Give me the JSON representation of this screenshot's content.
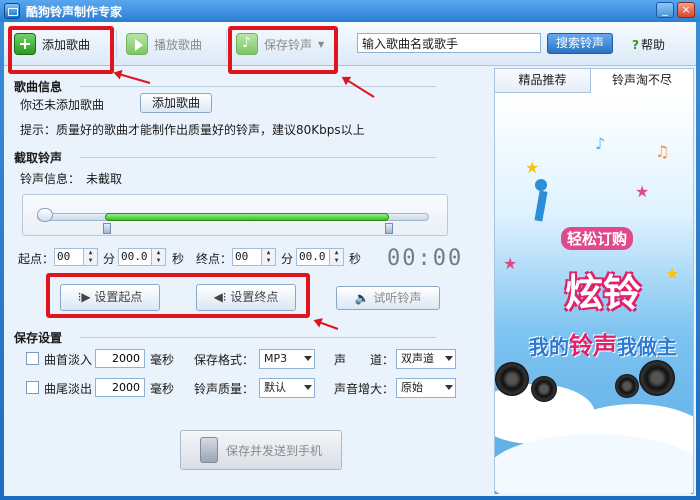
{
  "window": {
    "title": "酷狗铃声制作专家",
    "min": "_",
    "close": "×"
  },
  "toolbar": {
    "add_song": "添加歌曲",
    "play_song": "播放歌曲",
    "save_ringtone": "保存铃声",
    "search_placeholder": "输入歌曲名或歌手",
    "search_button": "搜索铃声",
    "help": "帮助"
  },
  "song_info": {
    "heading": "歌曲信息",
    "status": "你还未添加歌曲",
    "add_button": "添加歌曲",
    "tip": "提示：质量好的歌曲才能制作出质量好的铃声，建议80Kbps以上"
  },
  "cut": {
    "heading": "截取铃声",
    "info_label": "铃声信息：",
    "info_value": "未截取",
    "start_label": "起点：",
    "start_min": "00",
    "min_unit": "分",
    "start_sec": "00.0",
    "sec_unit": "秒",
    "end_label": "终点：",
    "end_min": "00",
    "end_sec": "00.0",
    "timer": "00:00",
    "set_start": "设置起点",
    "set_end": "设置终点",
    "preview": "试听铃声"
  },
  "save_settings": {
    "heading": "保存设置",
    "fade_in_label": "曲首淡入",
    "fade_in_value": "2000",
    "fade_out_label": "曲尾淡出",
    "fade_out_value": "2000",
    "ms_unit": "毫秒",
    "format_label": "保存格式：",
    "format_value": "MP3",
    "channel_label": "声　　道：",
    "channel_value": "双声道",
    "quality_label": "铃声质量：",
    "quality_value": "默认",
    "gain_label": "声音增大：",
    "gain_value": "原始",
    "save_send": "保存并发送到手机"
  },
  "right_panel": {
    "tabs": [
      "精品推荐",
      "铃声淘不尽"
    ],
    "ad": {
      "line1": "轻松订购",
      "line2": "炫铃",
      "line3a": "我的",
      "line3b": "铃声",
      "line3c": "我做主"
    }
  }
}
